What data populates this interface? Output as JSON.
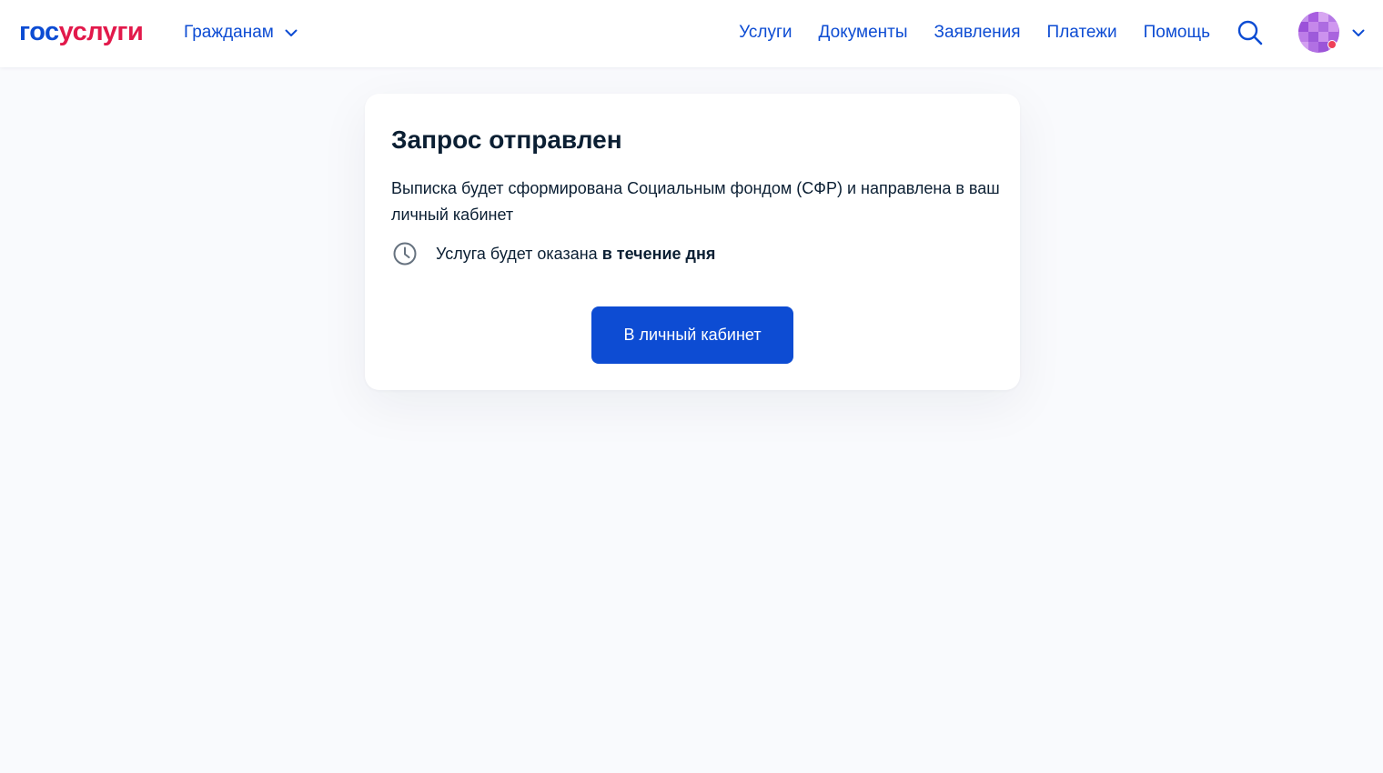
{
  "header": {
    "logo": {
      "part1": "гос",
      "part2": "услуги"
    },
    "audience_label": "Гражданам",
    "nav": [
      "Услуги",
      "Документы",
      "Заявления",
      "Платежи",
      "Помощь"
    ],
    "icons": {
      "search": "search-icon",
      "audience_dropdown": "chevron-down-icon",
      "profile_dropdown": "chevron-down-icon"
    }
  },
  "card": {
    "title": "Запрос отправлен",
    "description": "Выписка будет сформирована Социальным фондом (СФР) и направлена в ваш личный кабинет",
    "term_prefix": "Услуга будет оказана ",
    "term_bold": "в течение дня",
    "button_label": "В личный кабинет"
  },
  "colors": {
    "primary": "#0d4cd3",
    "brand_red": "#e2194b",
    "text": "#0b1f33",
    "page_bg": "#f9fafd",
    "card_bg": "#ffffff",
    "avatar_badge": "#ee3f58"
  }
}
